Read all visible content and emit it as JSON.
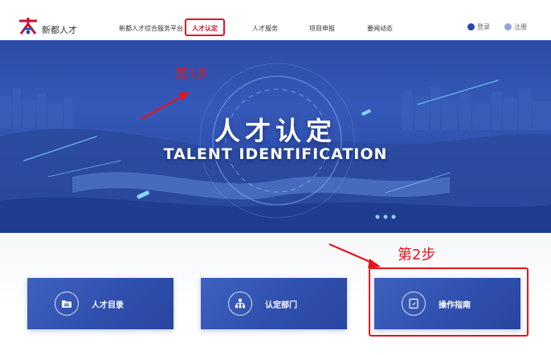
{
  "brand": {
    "name": "新都人才"
  },
  "nav": {
    "items": [
      {
        "label": "新都人才综合服务平台"
      },
      {
        "label": "人才认定"
      },
      {
        "label": "人才服务"
      },
      {
        "label": "项目申报"
      },
      {
        "label": "要闻动态"
      }
    ]
  },
  "auth": {
    "login": "登录",
    "register": "注册"
  },
  "banner": {
    "title": "人才认定",
    "subtitle": "TALENT IDENTIFICATION"
  },
  "annotations": {
    "step1": "第1步",
    "step2": "第2步"
  },
  "cards": [
    {
      "label": "人才目录",
      "icon": "folder-icon"
    },
    {
      "label": "认定部门",
      "icon": "org-chart-icon"
    },
    {
      "label": "操作指南",
      "icon": "guide-book-icon"
    }
  ],
  "colors": {
    "accent": "#e8131f",
    "brand_blue": "#2f50ae",
    "active_nav": "#c8102e"
  }
}
